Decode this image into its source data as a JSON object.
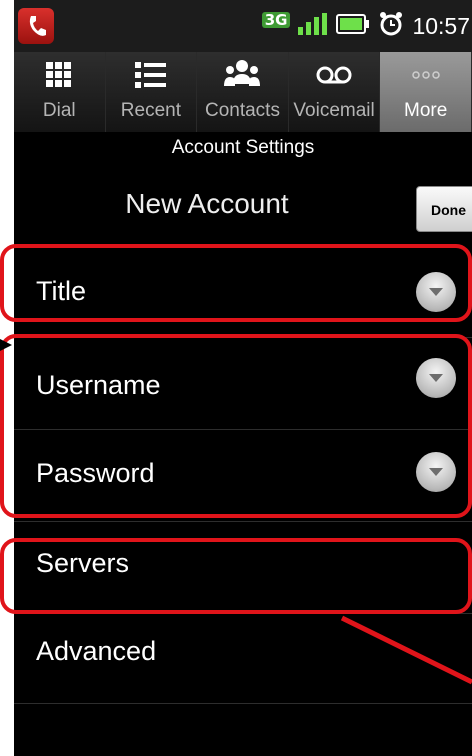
{
  "status_bar": {
    "network": "3G",
    "time": "10:57",
    "icons": [
      "app-icon",
      "3g-icon",
      "signal-icon",
      "battery-icon",
      "alarm-icon"
    ]
  },
  "tabs": [
    {
      "label": "Dial",
      "icon": "dialpad-icon",
      "active": false
    },
    {
      "label": "Recent",
      "icon": "list-icon",
      "active": false
    },
    {
      "label": "Contacts",
      "icon": "contacts-icon",
      "active": false
    },
    {
      "label": "Voicemail",
      "icon": "voicemail-icon",
      "active": false
    },
    {
      "label": "More",
      "icon": "more-icon",
      "active": true
    }
  ],
  "page": {
    "section_title": "Account Settings",
    "header_title": "New Account",
    "done_label": "Done"
  },
  "rows": [
    {
      "label": "Title",
      "expandable": true
    },
    {
      "label": "Username",
      "expandable": true
    },
    {
      "label": "Password",
      "expandable": true
    },
    {
      "label": "Servers",
      "expandable": false
    },
    {
      "label": "Advanced",
      "expandable": false
    }
  ],
  "colors": {
    "highlight": "#e0141a",
    "active_tab": "#8a8a8a",
    "background": "#000000"
  }
}
